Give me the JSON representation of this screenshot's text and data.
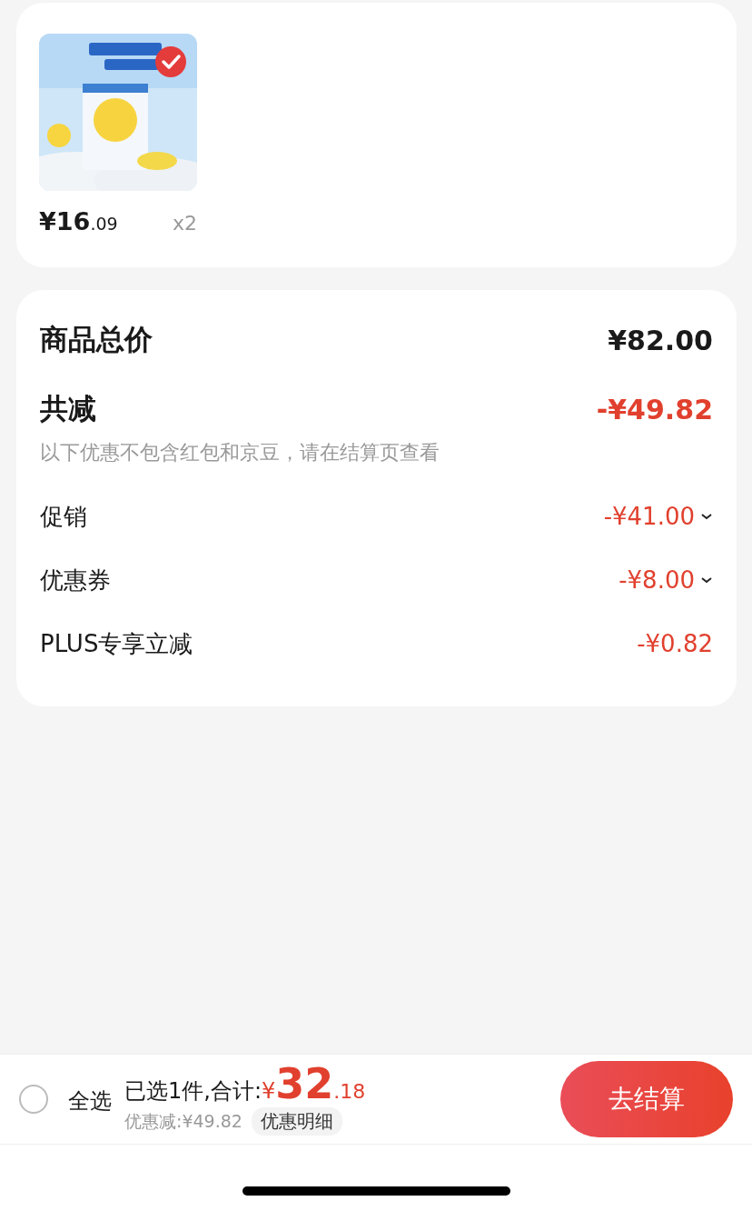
{
  "product": {
    "kind": "picture",
    "checked": true,
    "price_main": "¥16",
    "price_decimal": ".09",
    "quantity": "x2"
  },
  "summary": {
    "total_label": "商品总价",
    "total_value": "¥82.00",
    "discount_label": "共减",
    "discount_value": "-¥49.82",
    "note": "以下优惠不包含红包和京豆，请在结算页查看",
    "rows": [
      {
        "label": "促销",
        "value": "-¥41.00",
        "expandable": true
      },
      {
        "label": "优惠券",
        "value": "-¥8.00",
        "expandable": true
      },
      {
        "label": "PLUS专享立减",
        "value": "-¥0.82",
        "expandable": false
      }
    ]
  },
  "footer": {
    "select_all": {
      "label": "全选",
      "checked": false
    },
    "selected_text": "已选1件,合计:",
    "currency": "¥",
    "total_main": "32",
    "total_decimal": ".18",
    "saved": "优惠减:¥49.82",
    "detail_button": "优惠明细",
    "checkout_button": "去结算"
  }
}
